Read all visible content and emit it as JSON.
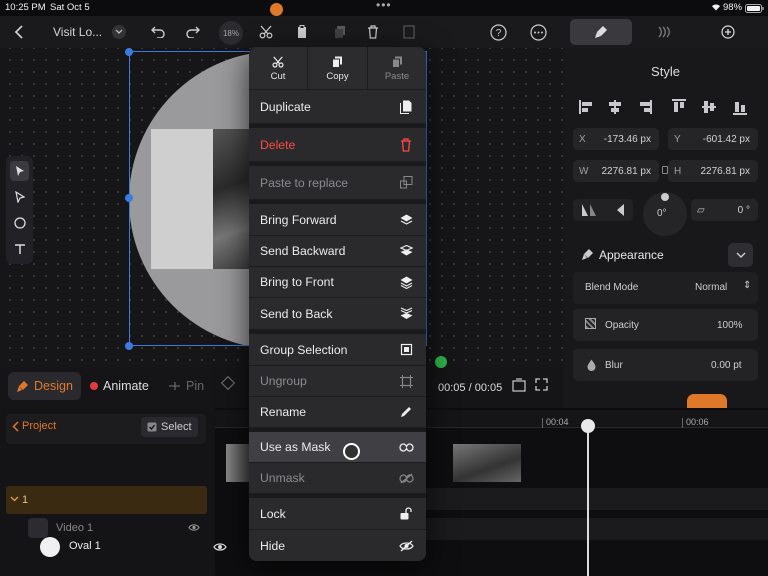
{
  "status_bar": {
    "time": "10:25 PM",
    "date": "Sat Oct 5",
    "battery": "98%"
  },
  "toolbar": {
    "doc_title": "Visit Lo...",
    "zoom": "18%",
    "icons": [
      "back-icon",
      "chevron-down-icon",
      "undo-icon",
      "redo-icon",
      "zoom-icon",
      "scissors-icon",
      "paste-icon",
      "copy-icon",
      "trash-icon",
      "paste-replace-icon",
      "help-icon",
      "more-icon"
    ]
  },
  "panel_tabs": [
    "style-tab",
    "animate-tab",
    "add-tab"
  ],
  "style_panel": {
    "title": "Style",
    "x_label": "X",
    "x_value": "-173.46 px",
    "y_label": "Y",
    "y_value": "-601.42 px",
    "w_label": "W",
    "w_value": "2276.81 px",
    "h_label": "H",
    "h_value": "2276.81 px",
    "rotation": "0°",
    "skew": "0 °",
    "appearance_title": "Appearance",
    "blend_mode_label": "Blend Mode",
    "blend_mode_value": "Normal",
    "opacity_label": "Opacity",
    "opacity_value": "100%",
    "blur_label": "Blur",
    "blur_value": "0.00 pt"
  },
  "mode_bar": {
    "design": "Design",
    "animate": "Animate",
    "pin": "Pin",
    "time": "00:05 / 00:05"
  },
  "timeline": {
    "project_label": "Project",
    "select_label": "Select",
    "group_label": "1",
    "ruler_ticks": [
      "00:04",
      "00:06"
    ],
    "layers": [
      {
        "name": "Video 1"
      },
      {
        "name": "Oval 1"
      }
    ]
  },
  "context_menu": {
    "top_actions": [
      {
        "label": "Cut",
        "icon": "scissors-icon",
        "enabled": true
      },
      {
        "label": "Copy",
        "icon": "copy-icon",
        "enabled": true
      },
      {
        "label": "Paste",
        "icon": "paste-icon",
        "enabled": false
      }
    ],
    "items": [
      {
        "label": "Duplicate",
        "icon": "duplicate-icon",
        "style": "normal"
      },
      {
        "label": "Delete",
        "icon": "trash-icon",
        "style": "danger"
      },
      {
        "label": "Paste to replace",
        "icon": "paste-replace-icon",
        "style": "dim"
      },
      {
        "label": "Bring Forward",
        "icon": "bring-forward-icon",
        "style": "normal"
      },
      {
        "label": "Send Backward",
        "icon": "send-backward-icon",
        "style": "normal"
      },
      {
        "label": "Bring to Front",
        "icon": "bring-front-icon",
        "style": "normal"
      },
      {
        "label": "Send to Back",
        "icon": "send-back-icon",
        "style": "normal"
      },
      {
        "label": "Group Selection",
        "icon": "group-icon",
        "style": "normal"
      },
      {
        "label": "Ungroup",
        "icon": "ungroup-icon",
        "style": "dim"
      },
      {
        "label": "Rename",
        "icon": "pencil-icon",
        "style": "normal"
      },
      {
        "label": "Use as Mask",
        "icon": "mask-icon",
        "style": "highlight"
      },
      {
        "label": "Unmask",
        "icon": "unmask-icon",
        "style": "dim"
      },
      {
        "label": "Lock",
        "icon": "unlock-icon",
        "style": "normal"
      },
      {
        "label": "Hide",
        "icon": "eye-slash-icon",
        "style": "normal"
      }
    ]
  },
  "colors": {
    "accent_orange": "#e0782a",
    "danger": "#ff4b43",
    "selection_blue": "#3b7be0",
    "green_dot": "#2fb34a"
  }
}
